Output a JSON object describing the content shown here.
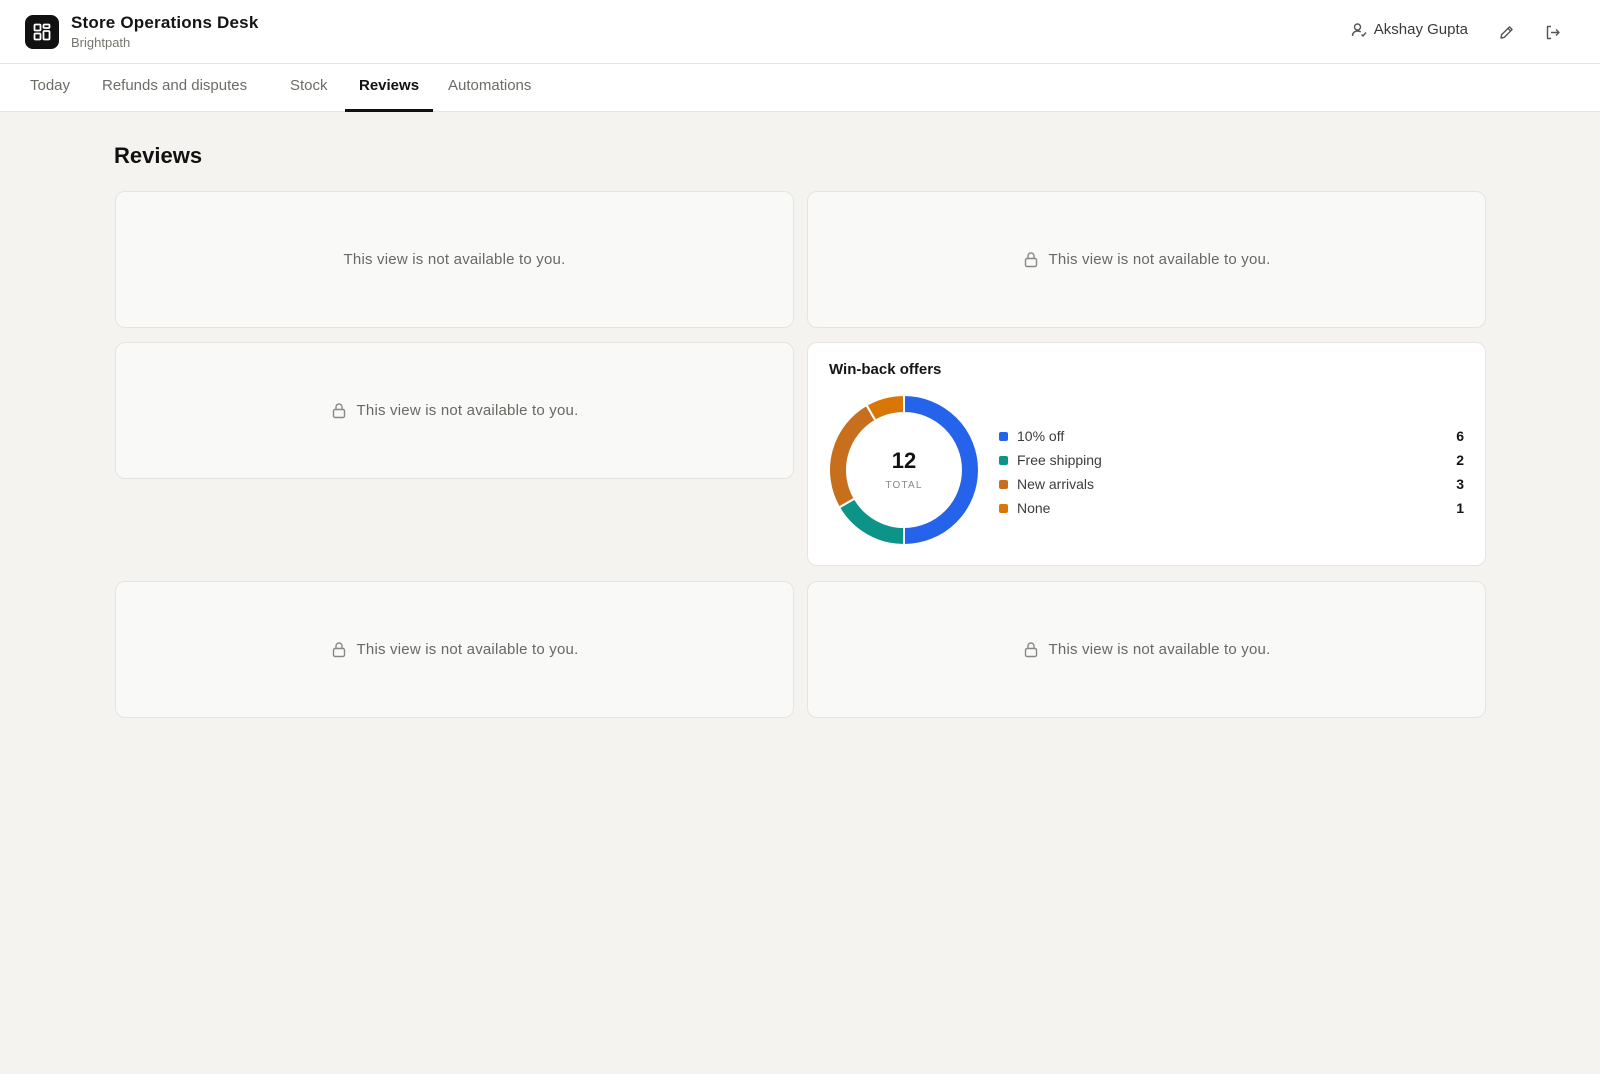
{
  "header": {
    "app_title": "Store Operations Desk",
    "app_subtitle": "Brightpath",
    "user_name": "Akshay Gupta"
  },
  "tabs": [
    {
      "label": "Today",
      "active": false
    },
    {
      "label": "Refunds and disputes",
      "active": false
    },
    {
      "label": "Stock",
      "active": false
    },
    {
      "label": "Reviews",
      "active": true
    },
    {
      "label": "Automations",
      "active": false
    }
  ],
  "page": {
    "title": "Reviews",
    "locked_message": "This view is not available to you."
  },
  "colors": {
    "accent": "#111111",
    "series": [
      "#2563eb",
      "#0d9488",
      "#c86f1e",
      "#d97706"
    ]
  },
  "widget": {
    "title": "Win-back offers",
    "total": "12",
    "total_label": "TOTAL"
  },
  "chart_data": {
    "type": "pie",
    "title": "Win-back offers",
    "categories": [
      "10% off",
      "Free shipping",
      "New arrivals",
      "None"
    ],
    "values": [
      6,
      2,
      3,
      1
    ],
    "total": 12,
    "legend": "right"
  }
}
